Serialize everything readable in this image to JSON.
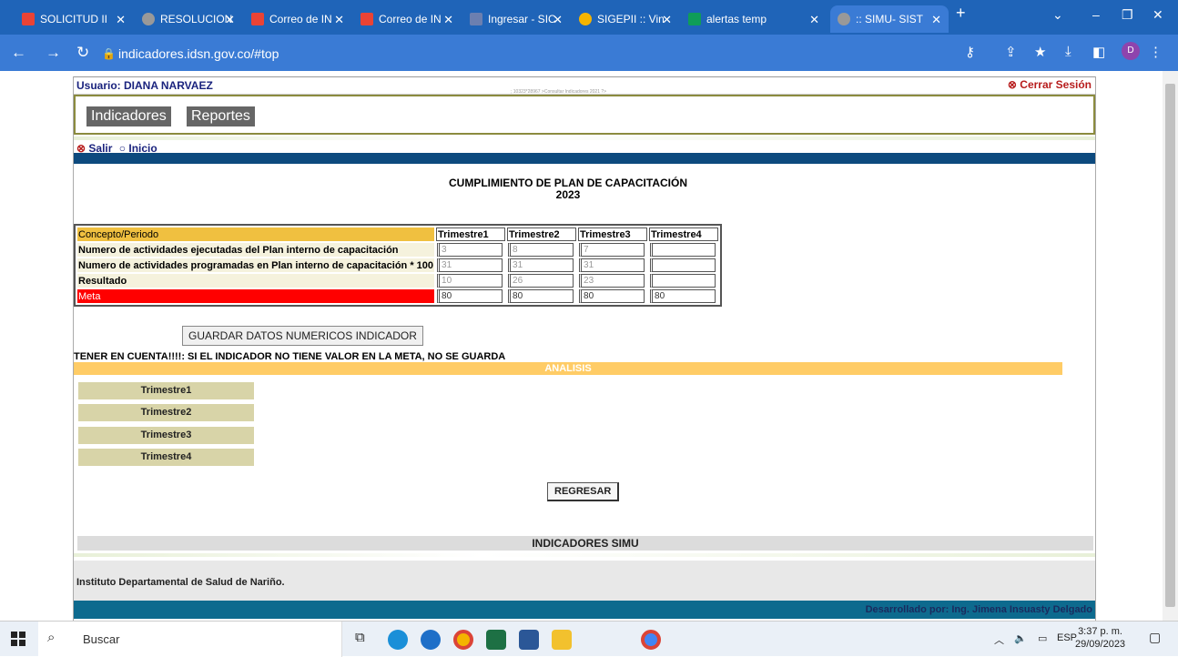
{
  "browser": {
    "tabs": [
      {
        "label": "SOLICITUD II",
        "color": "#ea4335"
      },
      {
        "label": "RESOLUCION",
        "color": "#999999"
      },
      {
        "label": "Correo de IN",
        "color": "#ea4335"
      },
      {
        "label": "Correo de IN",
        "color": "#ea4335"
      },
      {
        "label": "Ingresar - SIC",
        "color": "#6b7fb0"
      },
      {
        "label": "SIGEPII :: Vin",
        "color": "#f5b400"
      },
      {
        "label": "alertas temp",
        "color": "#0f9d58"
      },
      {
        "label": ":: SIMU- SIST",
        "color": "#999999"
      }
    ],
    "url": "indicadores.idsn.gov.co/#top",
    "profile_initial": "D"
  },
  "page": {
    "user_label": "Usuario: DIANA NARVAEZ",
    "logout_label": "Cerrar Sesión",
    "tiny_text": "; 10323*28967 >Consultar Indicadores 2021 ?>",
    "menu": [
      "Indicadores",
      "Reportes"
    ],
    "salir_label": "Salir",
    "inicio_label": "Inicio",
    "title_line1": "CUMPLIMIENTO DE PLAN DE CAPACITACIÓN",
    "title_line2": "2023",
    "table": {
      "header": [
        "Concepto/Periodo",
        "Trimestre1",
        "Trimestre2",
        "Trimestre3",
        "Trimestre4"
      ],
      "rows": [
        {
          "label": "Numero de actividades ejecutadas del Plan interno de capacitación",
          "values": [
            "3",
            "8",
            "7",
            ""
          ]
        },
        {
          "label": "Numero de actividades programadas en Plan interno de capacitación * 100",
          "values": [
            "31",
            "31",
            "31",
            ""
          ]
        },
        {
          "label": "Resultado",
          "values": [
            "10",
            "26",
            "23",
            ""
          ]
        },
        {
          "label": "Meta",
          "values": [
            "80",
            "80",
            "80",
            "80"
          ]
        }
      ]
    },
    "save_button": "GUARDAR DATOS NUMERICOS INDICADOR",
    "warning": "TENER EN CUENTA!!!!: SI EL INDICADOR NO TIENE VALOR EN LA META, NO SE GUARDA",
    "analisis_label": "ANALISIS",
    "trimestres": [
      "Trimestre1",
      "Trimestre2",
      "Trimestre3",
      "Trimestre4"
    ],
    "back_button": "REGRESAR",
    "footer_title": "INDICADORES SIMU",
    "institute": "Instituto Departamental de Salud de Nariño.",
    "developer": "Desarrollado por: Ing. Jimena Insuasty Delgado"
  },
  "taskbar": {
    "search_label": "Buscar",
    "lang": "ESP",
    "time": "3:37 p. m.",
    "date": "29/09/2023"
  }
}
